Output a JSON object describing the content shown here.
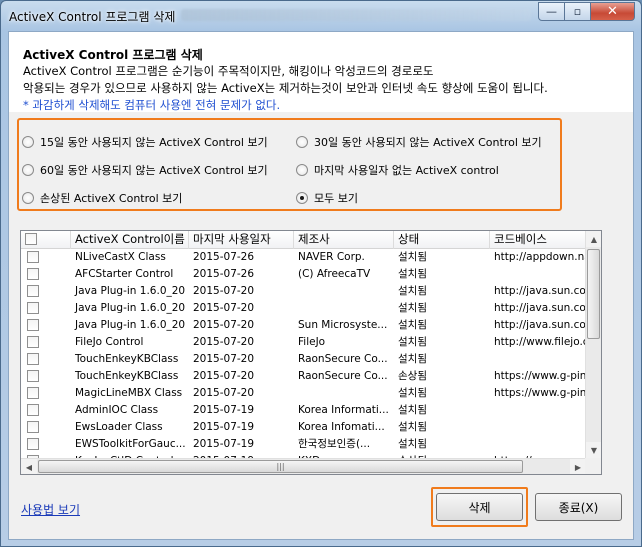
{
  "window": {
    "title": "ActiveX Control 프로그램 삭제",
    "caption": {
      "minimize": "—",
      "maximize": "▫",
      "close": "✕"
    }
  },
  "header": {
    "title": "ActiveX Control 프로그램 삭제",
    "line1": "ActiveX Control 프로그램은 순기능이 주목적이지만, 해킹이나 악성코드의 경로로도",
    "line2": "악용되는 경우가 있으므로 사용하지 않는 ActiveX는 제거하는것이 보안과 인터넷 속도 향상에 도움이 됩니다.",
    "note": "* 과감하게 삭제해도 컴퓨터 사용엔 전혀 문제가 없다."
  },
  "filters": [
    {
      "label": "15일 동안 사용되지 않는 ActiveX Control 보기",
      "selected": false
    },
    {
      "label": "30일 동안 사용되지 않는 ActiveX Control 보기",
      "selected": false
    },
    {
      "label": "60일 동안 사용되지 않는 ActiveX Control 보기",
      "selected": false
    },
    {
      "label": "마지막 사용일자 없는 ActiveX control",
      "selected": false
    },
    {
      "label": "손상된 ActiveX Control 보기",
      "selected": false
    },
    {
      "label": "모두 보기",
      "selected": true
    }
  ],
  "table": {
    "columns": [
      "",
      "ActiveX Control이름",
      "마지막 사용일자",
      "제조사",
      "상태",
      "코드베이스"
    ],
    "rows": [
      [
        "NLiveCastX Class",
        "2015-07-26",
        "NAVER Corp.",
        "설치됨",
        "http://appdown.naver"
      ],
      [
        "AFCStarter Control",
        "2015-07-26",
        "(C) AfreecaTV",
        "설치됨",
        ""
      ],
      [
        "Java Plug-in 1.6.0_20",
        "2015-07-20",
        "",
        "설치됨",
        "http://java.sun.com/"
      ],
      [
        "Java Plug-in 1.6.0_20",
        "2015-07-20",
        "",
        "설치됨",
        "http://java.sun.com/"
      ],
      [
        "Java Plug-in 1.6.0_20",
        "2015-07-20",
        "Sun Microsyste...",
        "설치됨",
        "http://java.sun.com/"
      ],
      [
        "FileJo Control",
        "2015-07-20",
        "FileJo",
        "설치됨",
        "http://www.filejo.com"
      ],
      [
        "TouchEnkeyKBClass",
        "2015-07-20",
        "RaonSecure Co...",
        "설치됨",
        ""
      ],
      [
        "TouchEnkeyKBClass",
        "2015-07-20",
        "RaonSecure Co...",
        "손상됨",
        "https://www.g-pin.go"
      ],
      [
        "MagicLineMBX Class",
        "2015-07-20",
        "",
        "설치됨",
        "https://www.g-pin.go"
      ],
      [
        "AdminIOC Class",
        "2015-07-19",
        "Korea Informati...",
        "설치됨",
        ""
      ],
      [
        "EwsLoader Class",
        "2015-07-19",
        "Korea Infomati...",
        "설치됨",
        ""
      ],
      [
        "EWSToolkitForGauc...",
        "2015-07-19",
        "한국정보인증(...",
        "설치됨",
        ""
      ],
      [
        "KxxIxxCtlD Control",
        "2015-07-19",
        "KXD",
        "손상됨",
        "https://www.xxxx.com"
      ]
    ]
  },
  "footer": {
    "help_link": "사용법 보기",
    "delete_label": "삭제",
    "close_label": "종료(X)"
  },
  "colors": {
    "highlight": "#f07b1c",
    "note": "#1f4fd1",
    "link": "#1a3ab8"
  }
}
